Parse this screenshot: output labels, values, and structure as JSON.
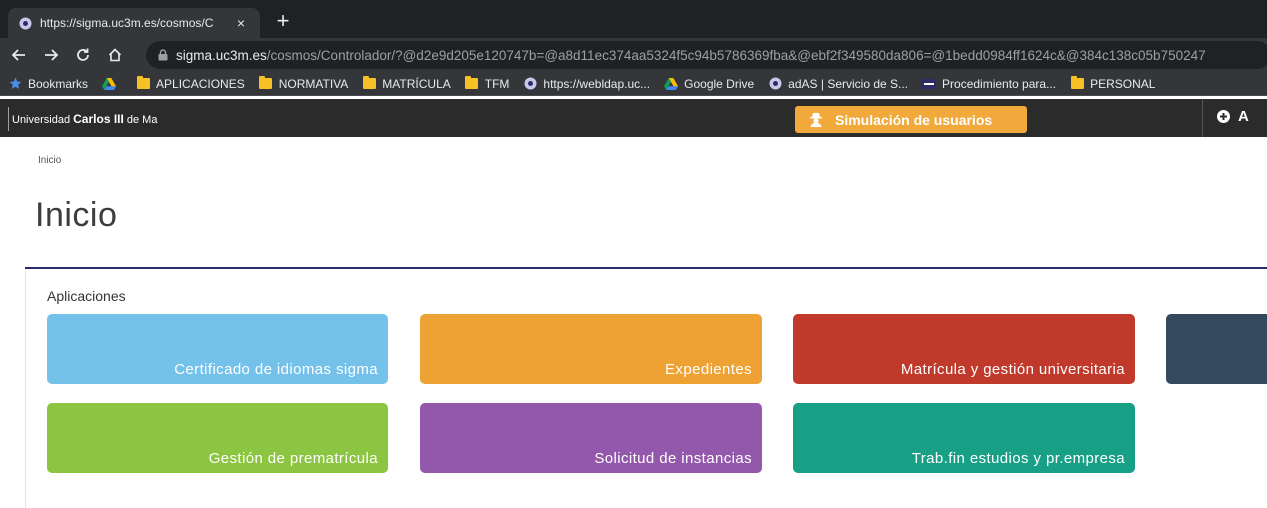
{
  "browser": {
    "tab_title": "https://sigma.uc3m.es/cosmos/C",
    "tab_close": "×",
    "new_tab": "+",
    "url_host": "sigma.uc3m.es",
    "url_path": "/cosmos/Controlador/?@d2e9d205e120747b=@a8d11ec374aa5324f5c94b5786369fba&@ebf2f349580da806=@1bedd0984ff1624c&@384c138c05b750247",
    "bookmarks": [
      {
        "label": "Bookmarks",
        "icon": "star-icon"
      },
      {
        "label": "",
        "icon": "google-drive-icon"
      },
      {
        "label": "APLICACIONES",
        "icon": "folder-icon"
      },
      {
        "label": "NORMATIVA",
        "icon": "folder-icon"
      },
      {
        "label": "MATRÍCULA",
        "icon": "folder-icon"
      },
      {
        "label": "TFM",
        "icon": "folder-icon"
      },
      {
        "label": "https://webldap.uc...",
        "icon": "globe-icon"
      },
      {
        "label": "Google Drive",
        "icon": "google-drive-icon"
      },
      {
        "label": "adAS | Servicio de S...",
        "icon": "globe-icon"
      },
      {
        "label": "Procedimiento para...",
        "icon": "uc3m-icon"
      },
      {
        "label": "PERSONAL",
        "icon": "folder-icon"
      }
    ]
  },
  "header": {
    "logo_prefix": "Universidad ",
    "logo_bold": "Carlos III",
    "logo_suffix": " de Ma",
    "sim_button": "Simulación de usuarios",
    "right_label": "A"
  },
  "page": {
    "breadcrumb": "Inicio",
    "title": "Inicio",
    "section": "Aplicaciones"
  },
  "tiles": [
    {
      "label": "Certificado de idiomas sigma",
      "color": "#74c1ea"
    },
    {
      "label": "Expedientes",
      "color": "#eea233"
    },
    {
      "label": "Matrícula y gestión universitaria",
      "color": "#c0392b"
    },
    {
      "label": "",
      "color": "#34495e"
    },
    {
      "label": "Gestión de prematrícula",
      "color": "#8bc541"
    },
    {
      "label": "Solicitud de instancias",
      "color": "#9358ab"
    },
    {
      "label": "Trab.fin estudios y pr.empresa",
      "color": "#17a086"
    }
  ]
}
